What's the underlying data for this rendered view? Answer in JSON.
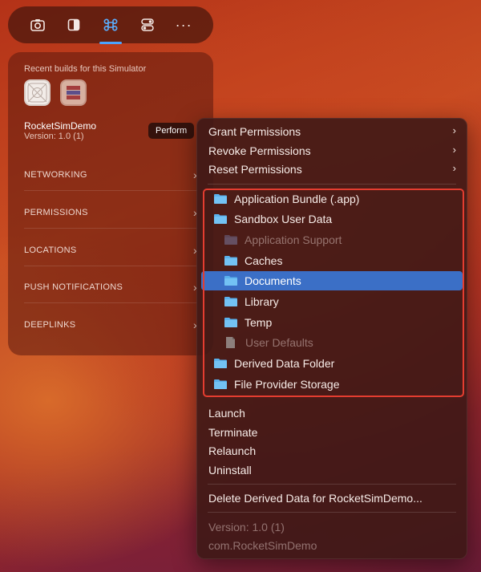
{
  "toolbar": {
    "icons": [
      "camera-icon",
      "sidebar-toggle-icon",
      "command-icon",
      "toggles-icon",
      "more-icon"
    ],
    "more_label": "···",
    "active_index": 2,
    "accent": "#4aa3ff"
  },
  "panel": {
    "recent_label": "Recent builds for this Simulator",
    "app_name": "RocketSimDemo",
    "app_version": "Version: 1.0 (1)",
    "perform_tooltip": "Perform",
    "sections": [
      "NETWORKING",
      "PERMISSIONS",
      "LOCATIONS",
      "PUSH NOTIFICATIONS",
      "DEEPLINKS"
    ]
  },
  "menu": {
    "permissions": {
      "grant": "Grant Permissions",
      "revoke": "Revoke Permissions",
      "reset": "Reset Permissions"
    },
    "folders": {
      "application_bundle": "Application Bundle (.app)",
      "sandbox_user_data": "Sandbox User Data",
      "application_support": "Application Support",
      "caches": "Caches",
      "documents": "Documents",
      "library": "Library",
      "temp": "Temp",
      "user_defaults": "User Defaults",
      "derived_data_folder": "Derived Data Folder",
      "file_provider_storage": "File Provider Storage"
    },
    "actions": {
      "launch": "Launch",
      "terminate": "Terminate",
      "relaunch": "Relaunch",
      "uninstall": "Uninstall",
      "delete_derived": "Delete Derived Data for RocketSimDemo..."
    },
    "info": {
      "version": "Version: 1.0 (1)",
      "bundle_id": "com.RocketSimDemo"
    },
    "highlight_color": "#3b6fc6",
    "annotation_color": "#e43d30"
  }
}
